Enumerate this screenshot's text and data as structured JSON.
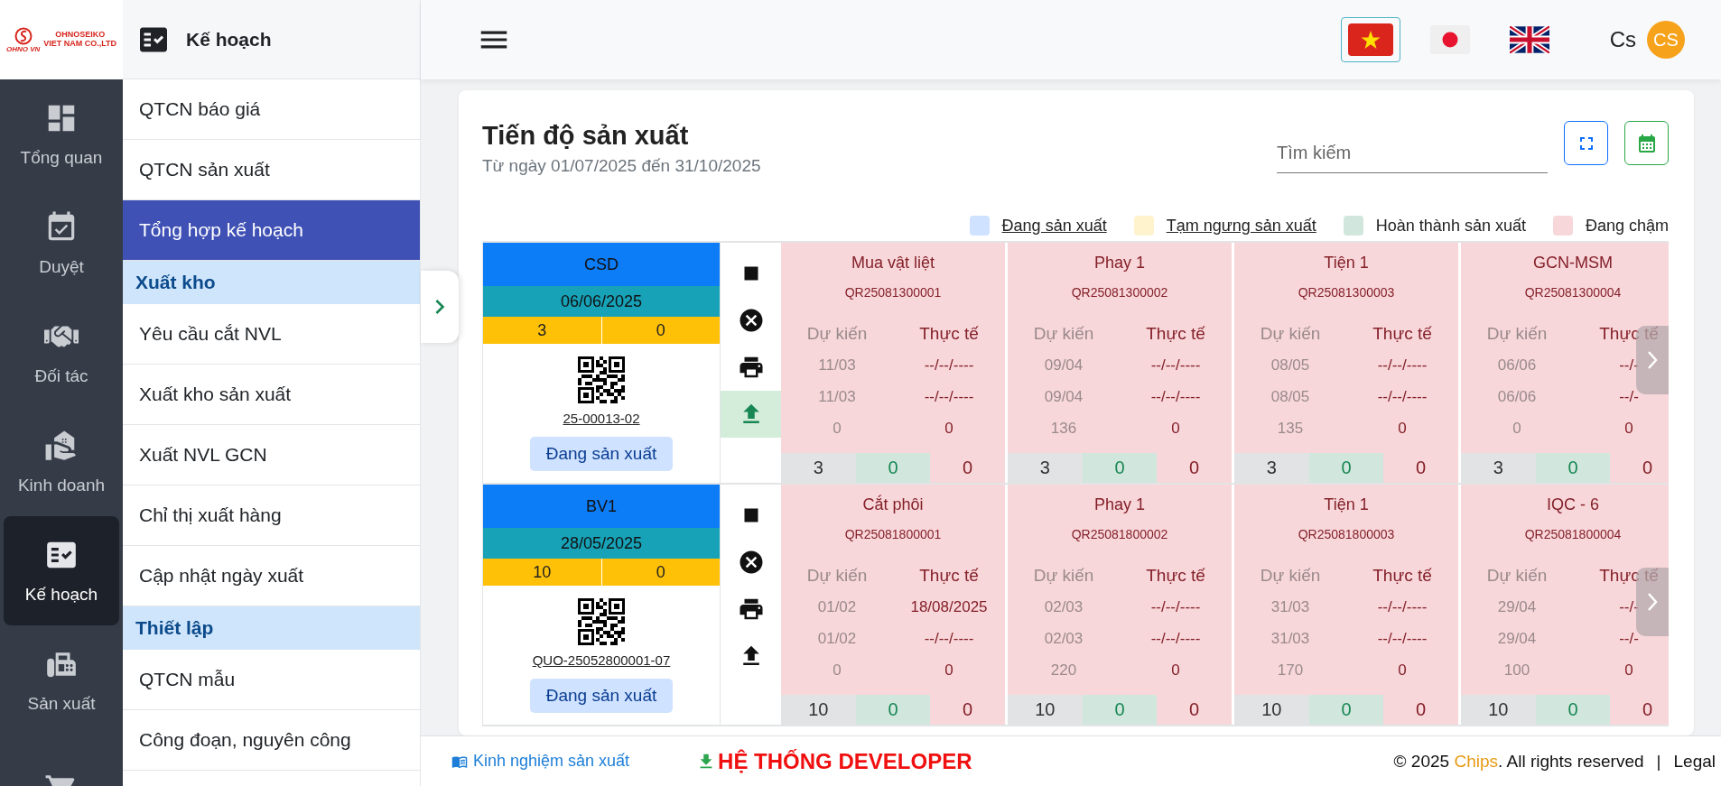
{
  "logo": {
    "mark": "OHNO VN",
    "line1": "OHNOSEIKO",
    "line2": "VIET NAM CO.,LTD"
  },
  "rail": [
    {
      "label": "Tổng quan",
      "selected": false
    },
    {
      "label": "Duyệt",
      "selected": false
    },
    {
      "label": "Đối tác",
      "selected": false
    },
    {
      "label": "Kinh doanh",
      "selected": false
    },
    {
      "label": "Kế hoạch",
      "selected": true
    },
    {
      "label": "Sản xuất",
      "selected": false
    },
    {
      "selected": false
    }
  ],
  "submenu": {
    "title": "Kế hoạch",
    "items": [
      {
        "kind": "item",
        "label": "QTCN báo giá",
        "selected": false
      },
      {
        "kind": "item",
        "label": "QTCN sản xuất",
        "selected": false
      },
      {
        "kind": "item",
        "label": "Tổng hợp kế hoạch",
        "selected": true
      },
      {
        "kind": "section",
        "label": "Xuất kho"
      },
      {
        "kind": "item",
        "label": "Yêu cầu cắt NVL",
        "selected": false
      },
      {
        "kind": "item",
        "label": "Xuất kho sản xuất",
        "selected": false
      },
      {
        "kind": "item",
        "label": "Xuất NVL GCN",
        "selected": false
      },
      {
        "kind": "item",
        "label": "Chỉ thị xuất hàng",
        "selected": false
      },
      {
        "kind": "item",
        "label": "Cập nhật ngày xuất",
        "selected": false
      },
      {
        "kind": "section",
        "label": "Thiết lập"
      },
      {
        "kind": "item",
        "label": "QTCN mẫu",
        "selected": false
      },
      {
        "kind": "item",
        "label": "Công đoạn, nguyên công",
        "selected": false
      }
    ]
  },
  "header": {
    "languages": [
      {
        "selected": true
      },
      {
        "selected": false
      },
      {
        "selected": false
      }
    ],
    "user": "Cs",
    "avatar": "CS"
  },
  "card": {
    "title": "Tiến độ sản xuất",
    "subtitle": "Từ ngày 01/07/2025 đến 31/10/2025",
    "search": {
      "placeholder": "Tìm kiếm"
    },
    "legend": [
      {
        "label": "Đang sản xuất",
        "color": "#cfe2ff",
        "linked": true
      },
      {
        "label": "Tạm ngưng sản xuất",
        "color": "#fff3cd",
        "linked": true
      },
      {
        "label": "Hoàn thành sản xuất",
        "color": "#d1e7dd",
        "linked": false
      },
      {
        "label": "Đang chậm",
        "color": "#f8d7da",
        "linked": false
      }
    ],
    "orders": [
      {
        "code": "CSD",
        "date": "06/06/2025",
        "qty_1": "3",
        "qty_2": "0",
        "number": "25-00013-02",
        "status": "Đang sản xuất",
        "uploaded": true,
        "stages": [
          {
            "name": "Mua vật liệt",
            "qr": "QR25081300001",
            "color": "#f8d7da",
            "planned_label": "Dự kiến",
            "actual_label": "Thực tế",
            "planned": [
              "11/03",
              "11/03",
              "0"
            ],
            "actual": [
              "--/--/----",
              "--/--/----",
              "0"
            ],
            "counts": [
              "3",
              "0",
              "0"
            ]
          },
          {
            "name": "Phay 1",
            "qr": "QR25081300002",
            "color": "#f8d7da",
            "planned_label": "Dự kiến",
            "actual_label": "Thực tế",
            "planned": [
              "09/04",
              "09/04",
              "136"
            ],
            "actual": [
              "--/--/----",
              "--/--/----",
              "0"
            ],
            "counts": [
              "3",
              "0",
              "0"
            ]
          },
          {
            "name": "Tiện 1",
            "qr": "QR25081300003",
            "color": "#f8d7da",
            "planned_label": "Dự kiến",
            "actual_label": "Thực tế",
            "planned": [
              "08/05",
              "08/05",
              "135"
            ],
            "actual": [
              "--/--/----",
              "--/--/----",
              "0"
            ],
            "counts": [
              "3",
              "0",
              "0"
            ]
          },
          {
            "name": "GCN-MSM",
            "qr": "QR25081300004",
            "color": "#f8d7da",
            "planned_label": "Dự kiến",
            "actual_label": "Thực tế",
            "planned": [
              "06/06",
              "06/06",
              "0"
            ],
            "actual": [
              "--/-",
              "--/-",
              "0"
            ],
            "counts": [
              "3",
              "0",
              "0"
            ]
          }
        ]
      },
      {
        "code": "BV1",
        "date": "28/05/2025",
        "qty_1": "10",
        "qty_2": "0",
        "number": "QUO-25052800001-07",
        "status": "Đang sản xuất",
        "uploaded": false,
        "stages": [
          {
            "name": "Cắt phôi",
            "qr": "QR25081800001",
            "color": "#f8d7da",
            "planned_label": "Dự kiến",
            "actual_label": "Thực tế",
            "planned": [
              "01/02",
              "01/02",
              "0"
            ],
            "actual": [
              "18/08/2025",
              "--/--/----",
              "0"
            ],
            "counts": [
              "10",
              "0",
              "0"
            ]
          },
          {
            "name": "Phay 1",
            "qr": "QR25081800002",
            "color": "#f8d7da",
            "planned_label": "Dự kiến",
            "actual_label": "Thực tế",
            "planned": [
              "02/03",
              "02/03",
              "220"
            ],
            "actual": [
              "--/--/----",
              "--/--/----",
              "0"
            ],
            "counts": [
              "10",
              "0",
              "0"
            ]
          },
          {
            "name": "Tiện 1",
            "qr": "QR25081800003",
            "color": "#f8d7da",
            "planned_label": "Dự kiến",
            "actual_label": "Thực tế",
            "planned": [
              "31/03",
              "31/03",
              "170"
            ],
            "actual": [
              "--/--/----",
              "--/--/----",
              "0"
            ],
            "counts": [
              "10",
              "0",
              "0"
            ]
          },
          {
            "name": "IQC - 6",
            "qr": "QR25081800004",
            "color": "#f8d7da",
            "planned_label": "Dự kiến",
            "actual_label": "Thực tế",
            "planned": [
              "29/04",
              "29/04",
              "100"
            ],
            "actual": [
              "--/-",
              "--/-",
              "0"
            ],
            "counts": [
              "10",
              "0",
              "0"
            ]
          }
        ]
      }
    ]
  },
  "footer": {
    "experience_link": "Kinh nghiệm sản xuất",
    "developer_banner": "HỆ THỐNG DEVELOPER",
    "copyright_before": "© 2025 ",
    "brand": "Chips",
    "copyright_after": ". All rights reserved",
    "separator": "|",
    "legal": "Legal"
  }
}
